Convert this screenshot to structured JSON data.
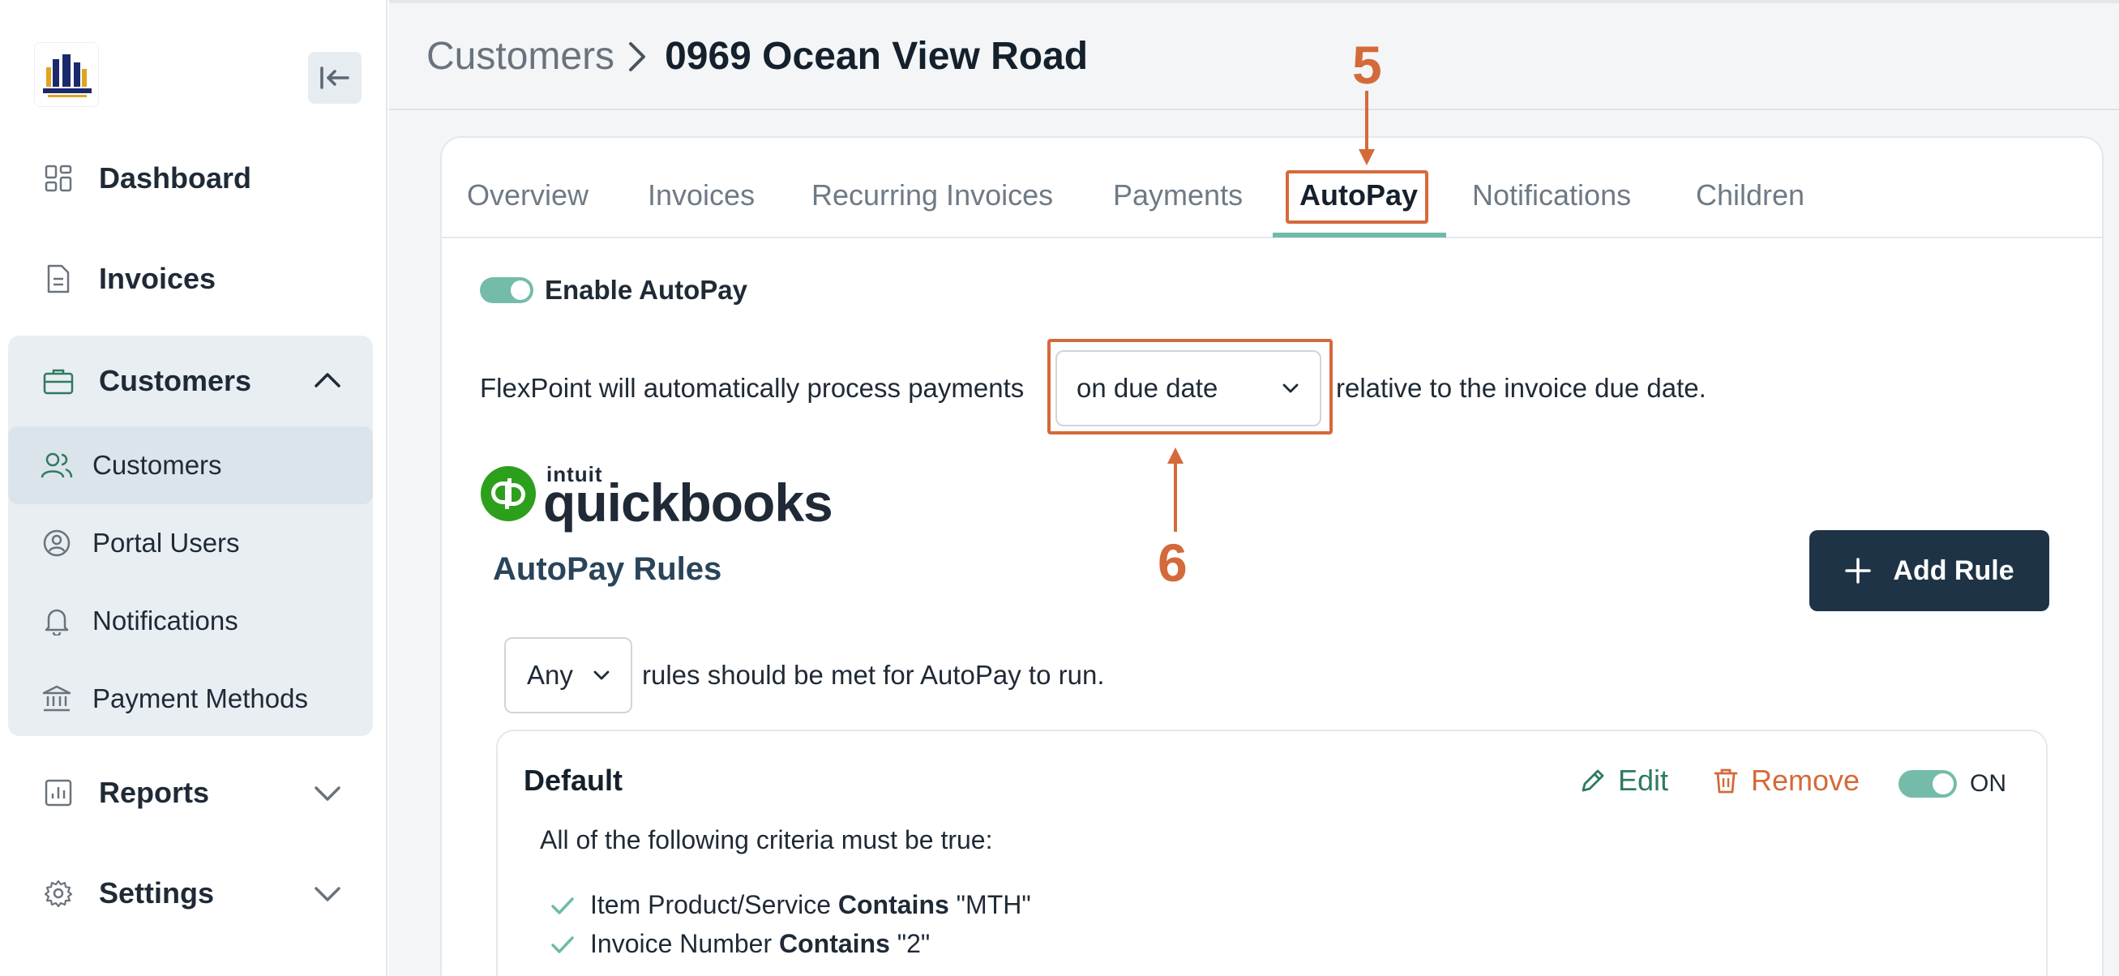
{
  "sidebar": {
    "items": {
      "dashboard": "Dashboard",
      "invoices": "Invoices",
      "customers": "Customers",
      "reports": "Reports",
      "settings": "Settings"
    },
    "customers_sub": {
      "customers": "Customers",
      "portal_users": "Portal Users",
      "notifications": "Notifications",
      "payment_methods": "Payment Methods"
    }
  },
  "breadcrumb": {
    "parent": "Customers",
    "current": "0969 Ocean View Road"
  },
  "tabs": [
    "Overview",
    "Invoices",
    "Recurring Invoices",
    "Payments",
    "AutoPay",
    "Notifications",
    "Children"
  ],
  "autopay": {
    "enable_label": "Enable AutoPay",
    "sentence_before": "FlexPoint will automatically process payments",
    "timing_selected": "on due date",
    "sentence_after": "relative to the invoice due date.",
    "brand_small": "intuit",
    "brand_big": "quickbooks",
    "rules_title": "AutoPay Rules",
    "add_rule_label": "Add Rule",
    "match_selected": "Any",
    "match_sentence": "rules should be met for AutoPay to run."
  },
  "rule": {
    "name": "Default",
    "edit_label": "Edit",
    "remove_label": "Remove",
    "status_label": "ON",
    "criteria_intro": "All of the following criteria must be true:",
    "criteria": [
      {
        "field": "Item Product/Service",
        "op": "Contains",
        "value": "\"MTH\""
      },
      {
        "field": "Invoice Number",
        "op": "Contains",
        "value": "\"2\""
      }
    ]
  },
  "annotations": {
    "step_tab": "5",
    "step_select": "6"
  },
  "colors": {
    "accent_teal": "#6fbbab",
    "annotation_orange": "#d46a3a",
    "primary_dark": "#1f3346",
    "edit_green": "#2f7a5f"
  }
}
